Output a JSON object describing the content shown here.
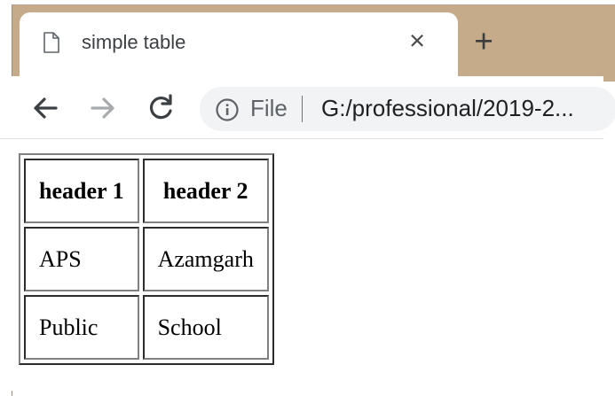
{
  "browser": {
    "tab": {
      "title": "simple table",
      "close_glyph": "×",
      "icon": "document-icon"
    },
    "new_tab_glyph": "+",
    "toolbar": {
      "back_icon": "back-arrow-icon",
      "forward_icon": "forward-arrow-icon",
      "reload_icon": "reload-icon"
    },
    "omnibox": {
      "info_icon": "info-icon",
      "scheme_label": "File",
      "url": "G:/professional/2019-2..."
    }
  },
  "page": {
    "table": {
      "headers": [
        "header 1",
        "header 2"
      ],
      "rows": [
        [
          "APS",
          "Azamgarh"
        ],
        [
          "Public",
          "School"
        ]
      ]
    }
  },
  "colors": {
    "tab_strip": "#c5ab8a",
    "omnibox_bg": "#f1f3f4",
    "page_bg": "#ffffff"
  }
}
